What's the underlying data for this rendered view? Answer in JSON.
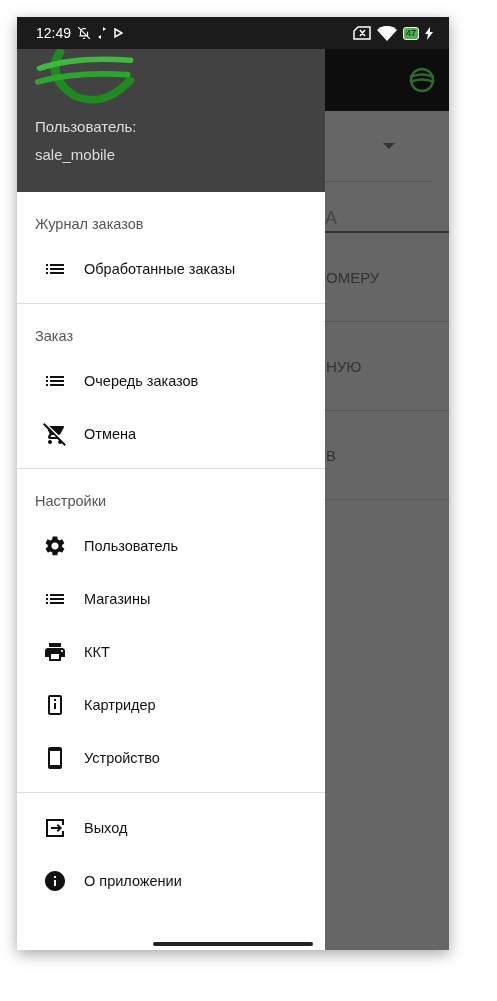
{
  "status_bar": {
    "time": "12:49",
    "battery": "47"
  },
  "background": {
    "field_text": "А",
    "rows": [
      "ОМЕРУ",
      "НУЮ",
      "В"
    ]
  },
  "drawer": {
    "user_label": "Пользователь:",
    "user_name": "sale_mobile",
    "sections": [
      {
        "title": "Журнал заказов",
        "items": [
          {
            "kind": "list",
            "label": "Обработанные заказы"
          }
        ]
      },
      {
        "title": "Заказ",
        "items": [
          {
            "kind": "list",
            "label": "Очередь заказов"
          },
          {
            "kind": "cart-off",
            "label": "Отмена"
          }
        ]
      },
      {
        "title": "Настройки",
        "items": [
          {
            "kind": "gear",
            "label": "Пользователь"
          },
          {
            "kind": "list",
            "label": "Магазины"
          },
          {
            "kind": "printer",
            "label": "ККТ"
          },
          {
            "kind": "reader",
            "label": "Картридер"
          },
          {
            "kind": "phone",
            "label": "Устройство"
          }
        ]
      },
      {
        "items": [
          {
            "kind": "exit",
            "label": "Выход"
          },
          {
            "kind": "info",
            "label": "О приложении"
          }
        ]
      }
    ]
  }
}
